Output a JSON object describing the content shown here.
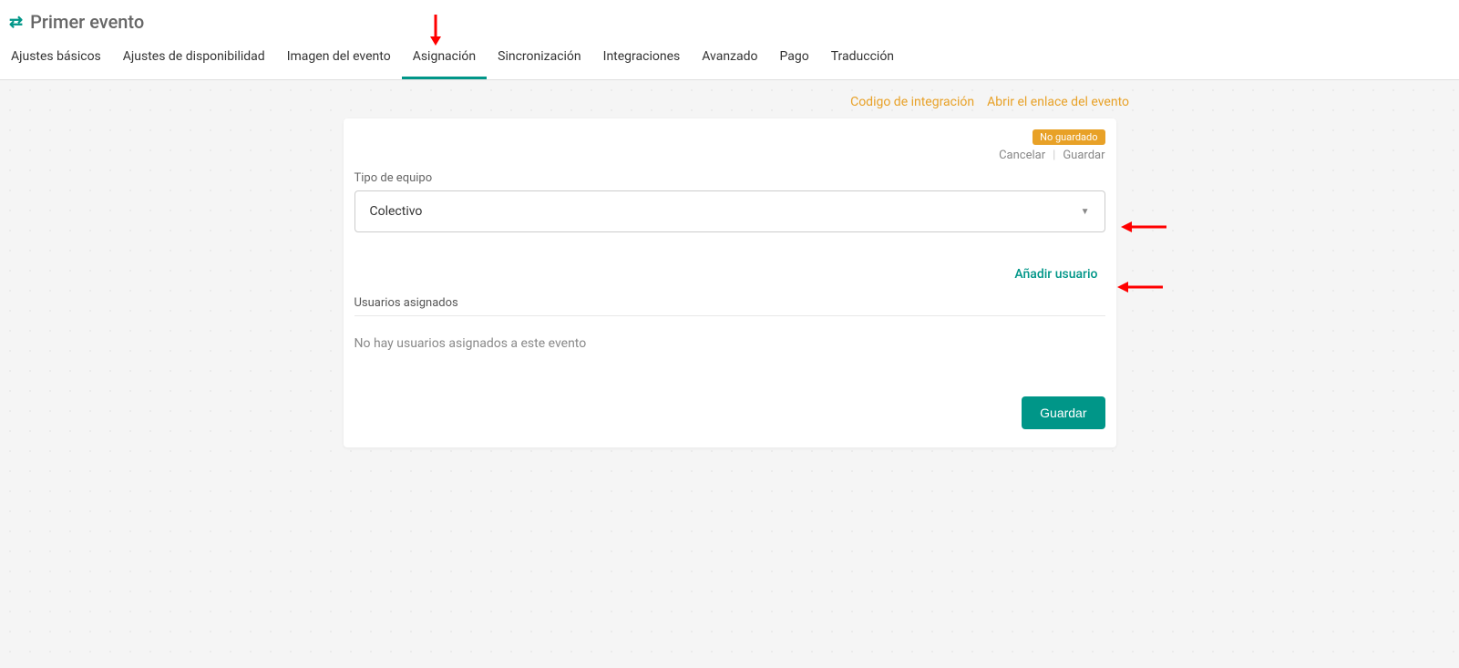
{
  "page_title": "Primer evento",
  "tabs": [
    {
      "label": "Ajustes básicos"
    },
    {
      "label": "Ajustes de disponibilidad"
    },
    {
      "label": "Imagen del evento"
    },
    {
      "label": "Asignación",
      "active": true
    },
    {
      "label": "Sincronización"
    },
    {
      "label": "Integraciones"
    },
    {
      "label": "Avanzado"
    },
    {
      "label": "Pago"
    },
    {
      "label": "Traducción"
    }
  ],
  "top_links": {
    "integration_code": "Codigo de integración",
    "open_event_link": "Abrir el enlace del evento"
  },
  "card": {
    "badge": "No guardado",
    "cancel": "Cancelar",
    "save": "Guardar",
    "team_type_label": "Tipo de equipo",
    "team_type_value": "Colectivo",
    "add_user": "Añadir usuario",
    "assigned_users_label": "Usuarios asignados",
    "empty_users": "No hay usuarios asignados a este evento",
    "save_button": "Guardar"
  }
}
